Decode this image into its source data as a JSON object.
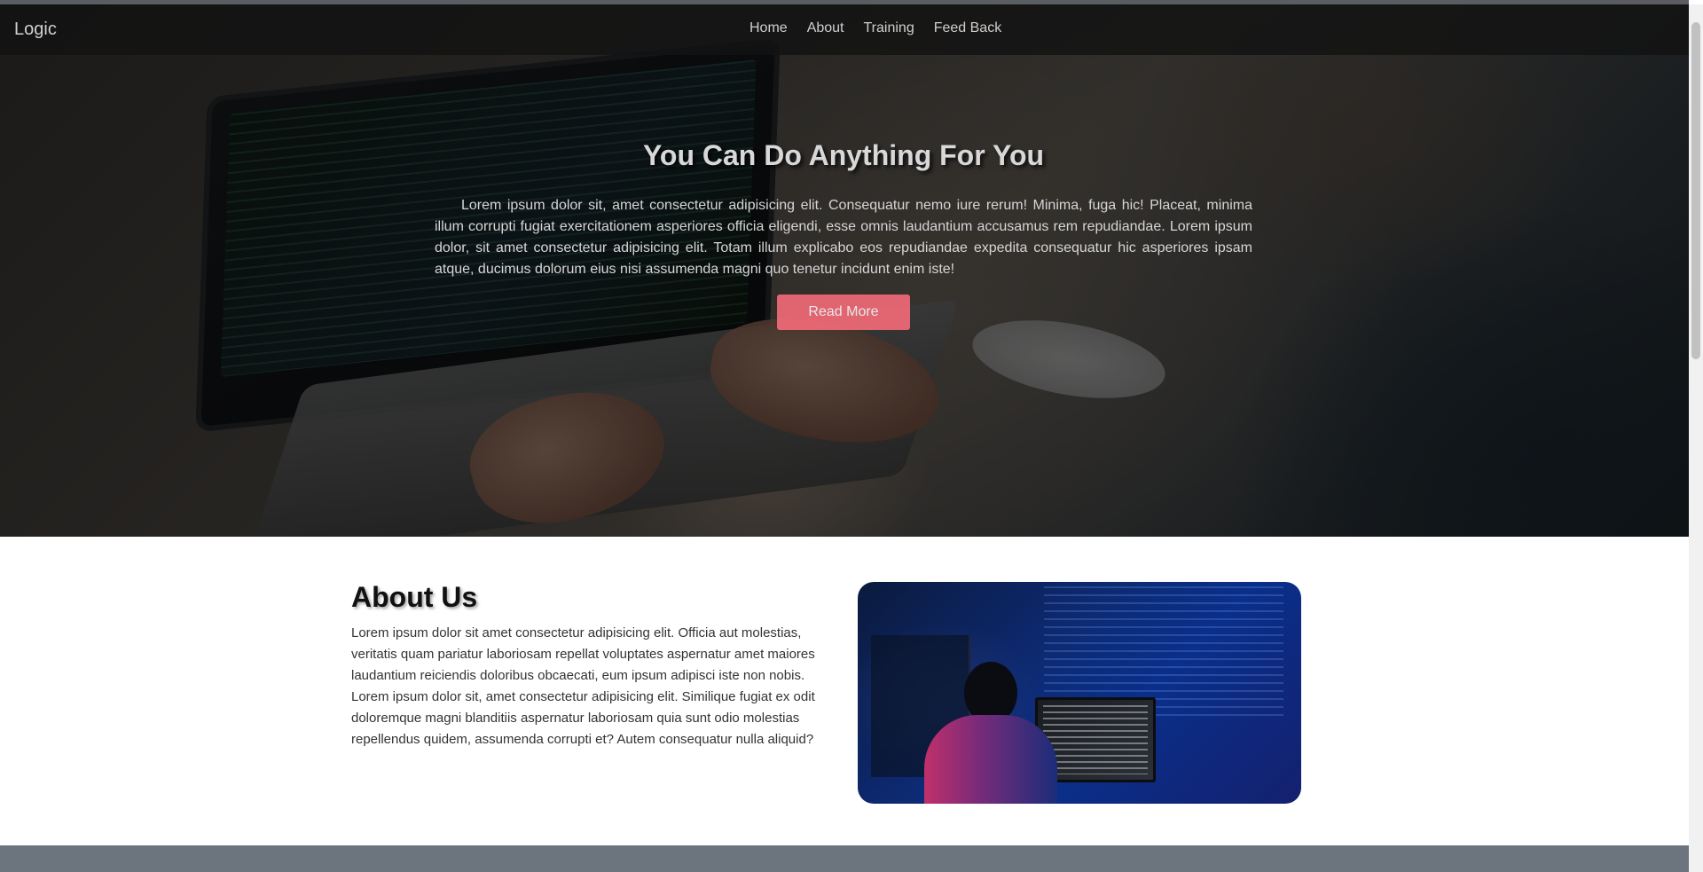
{
  "navbar": {
    "brand": "Logic",
    "links": [
      {
        "label": "Home"
      },
      {
        "label": "About"
      },
      {
        "label": "Training"
      },
      {
        "label": "Feed Back"
      }
    ]
  },
  "hero": {
    "title": "You Can Do Anything For You",
    "text": "Lorem ipsum dolor sit, amet consectetur adipisicing elit. Consequatur nemo iure rerum! Minima, fuga hic! Placeat, minima illum corrupti fugiat exercitationem asperiores officia eligendi, esse omnis laudantium accusamus rem repudiandae. Lorem ipsum dolor, sit amet consectetur adipisicing elit. Totam illum explicabo eos repudiandae expedita consequatur hic asperiores ipsam atque, ducimus dolorum eius nisi assumenda magni quo tenetur incidunt enim iste!",
    "button": "Read More",
    "button_color": "#ff6e7d"
  },
  "about": {
    "title": "About Us",
    "text": "Lorem ipsum dolor sit amet consectetur adipisicing elit. Officia aut molestias, veritatis quam pariatur laboriosam repellat voluptates aspernatur amet maiores laudantium reiciendis doloribus obcaecati, eum ipsum adipisci iste non nobis. Lorem ipsum dolor sit, amet consectetur adipisicing elit. Similique fugiat ex odit doloremque magni blanditiis aspernatur laboriosam quia sunt odio molestias repellendus quidem, assumenda corrupti et? Autem consequatur nulla aliquid?"
  },
  "colors": {
    "footer_band": "#6c757d",
    "navbar": "#121212"
  }
}
